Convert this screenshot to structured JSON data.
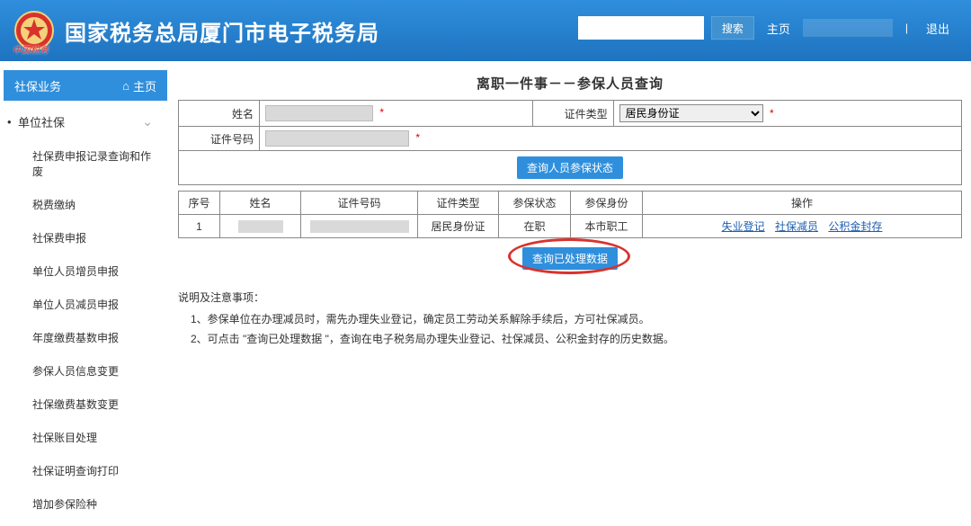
{
  "header": {
    "title": "国家税务总局厦门市电子税务局",
    "logo_sub": "中国税务",
    "search_btn": "搜索",
    "home_link": "主页",
    "logout_link": "退出"
  },
  "sidebar": {
    "head": "社保业务",
    "home": "主页",
    "parent": "单位社保",
    "items": [
      "社保费申报记录查询和作废",
      "税费缴纳",
      "社保费申报",
      "单位人员增员申报",
      "单位人员减员申报",
      "年度缴费基数申报",
      "参保人员信息变更",
      "社保缴费基数变更",
      "社保账目处理",
      "社保证明查询打印",
      "增加参保险种"
    ]
  },
  "page": {
    "title": "离职一件事－－参保人员查询",
    "form": {
      "name_label": "姓名",
      "idtype_label": "证件类型",
      "idtype_value": "居民身份证",
      "idno_label": "证件号码"
    },
    "query_status_btn": "查询人员参保状态",
    "table": {
      "headers": [
        "序号",
        "姓名",
        "证件号码",
        "证件类型",
        "参保状态",
        "参保身份",
        "操作"
      ],
      "row": {
        "seq": "1",
        "idtype": "居民身份证",
        "status": "在职",
        "identity": "本市职工",
        "ops": [
          "失业登记",
          "社保减员",
          "公积金封存"
        ]
      }
    },
    "query_processed_btn": "查询已处理数据",
    "notes": {
      "title": "说明及注意事项：",
      "items": [
        "1、参保单位在办理减员时，需先办理失业登记，确定员工劳动关系解除手续后，方可社保减员。",
        "2、可点击 \"查询已处理数据 \"，查询在电子税务局办理失业登记、社保减员、公积金封存的历史数据。"
      ]
    }
  }
}
